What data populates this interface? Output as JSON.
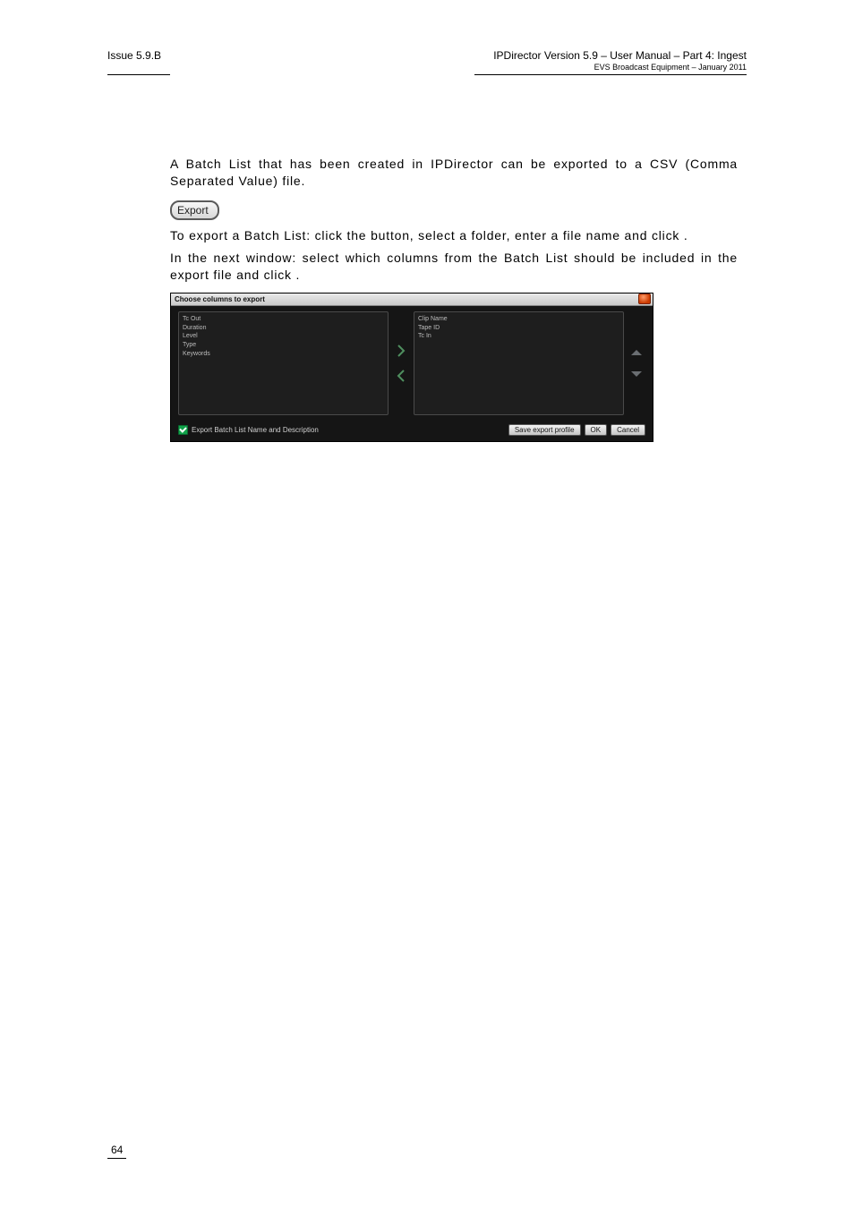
{
  "header": {
    "left": "Issue 5.9.B",
    "right_main": "IPDirector Version 5.9 – User Manual – Part 4: Ingest",
    "right_sub": "EVS Broadcast Equipment – January 2011"
  },
  "paragraphs": {
    "p1": "A Batch List that has been created in IPDirector can be exported to a CSV (Comma Separated Value) file.",
    "p2_a": "To export a Batch List: click the ",
    "p2_b": " button, select a folder, enter a file name and click ",
    "p2_c": ".",
    "p3_a": "In the next window: select which columns from the Batch List should be included in the export file and click ",
    "p3_b": "."
  },
  "export_button": {
    "label": "Export"
  },
  "dialog": {
    "title": "Choose columns to export",
    "left_list": [
      "Tc Out",
      "Duration",
      "Level",
      "Type",
      "Keywords"
    ],
    "right_list": [
      "Clip Name",
      "Tape ID",
      "Tc In"
    ],
    "checkbox_label": "Export Batch List Name and Description",
    "buttons": {
      "save_profile": "Save export profile",
      "ok": "OK",
      "cancel": "Cancel"
    }
  },
  "footer": {
    "page_number": "64"
  }
}
